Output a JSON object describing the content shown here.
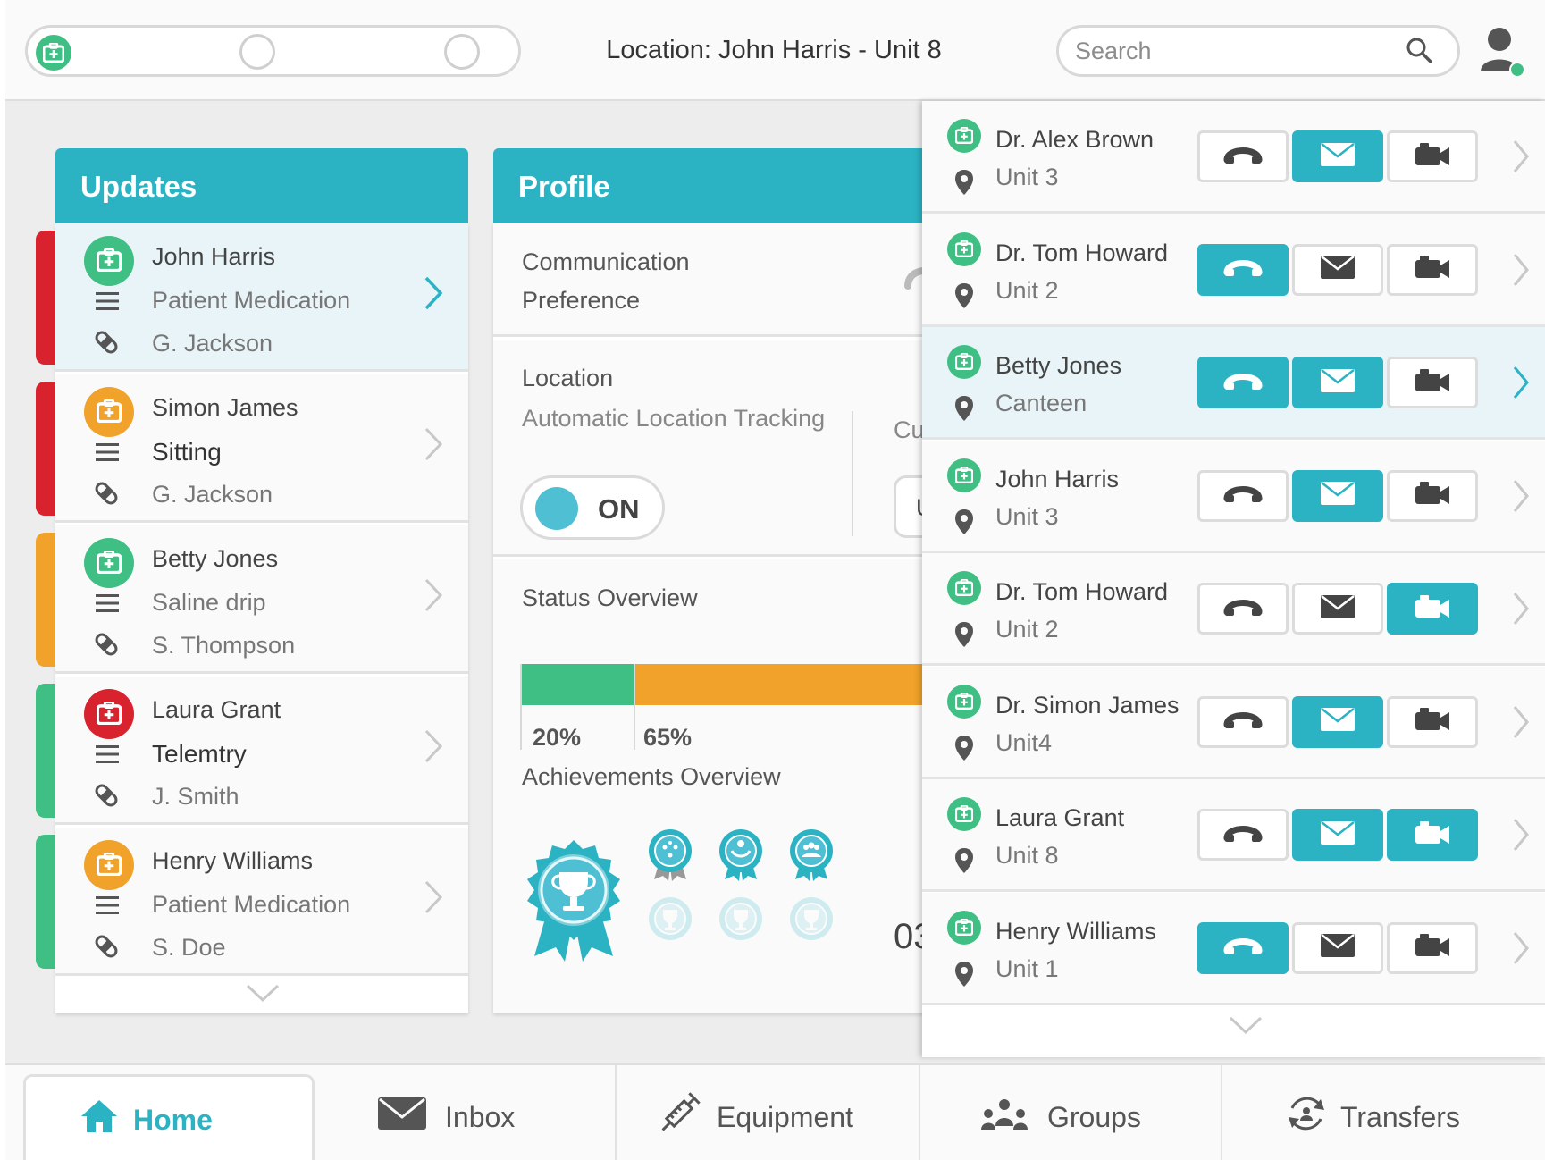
{
  "header": {
    "location": "Location: John Harris - Unit 8",
    "search_placeholder": "Search"
  },
  "colors": {
    "accent": "#2bb3c4",
    "green": "#3fbf84",
    "orange": "#f0a22a",
    "red": "#d8232e"
  },
  "updates": {
    "title": "Updates",
    "items": [
      {
        "name": "John Harris",
        "detail": "Patient Medication",
        "staff": "G. Jackson",
        "priority": "red",
        "category": "green"
      },
      {
        "name": "Simon James",
        "detail": "Sitting",
        "staff": "G. Jackson",
        "priority": "red",
        "category": "orange"
      },
      {
        "name": "Betty Jones",
        "detail": "Saline drip",
        "staff": "S. Thompson",
        "priority": "orange",
        "category": "green"
      },
      {
        "name": "Laura Grant",
        "detail": "Telemtry",
        "staff": "J. Smith",
        "priority": "green",
        "category": "red"
      },
      {
        "name": "Henry Williams",
        "detail": "Patient Medication",
        "staff": "S. Doe",
        "priority": "green",
        "category": "orange"
      }
    ]
  },
  "profile": {
    "title": "Profile",
    "communication_line1": "Communication",
    "communication_line2": "Preference",
    "location_title": "Location",
    "location_sub": "Automatic Location Tracking",
    "toggle_label": "ON",
    "cut_label": "Cu",
    "cut_box": "U",
    "status_title": "Status Overview",
    "status_green_pct": "20%",
    "status_orange_pct": "65%",
    "status_green_value": 20,
    "status_orange_value": 65,
    "achievements_title": "Achievements Overview",
    "achievements_cut_number": "03"
  },
  "contacts": [
    {
      "name": "Dr. Alex Brown",
      "location": "Unit 3",
      "call": false,
      "mail": true,
      "video": false
    },
    {
      "name": "Dr. Tom Howard",
      "location": "Unit 2",
      "call": true,
      "mail": false,
      "video": false
    },
    {
      "name": "Betty Jones",
      "location": "Canteen",
      "call": true,
      "mail": true,
      "video": false
    },
    {
      "name": "John Harris",
      "location": "Unit 3",
      "call": false,
      "mail": true,
      "video": false
    },
    {
      "name": "Dr. Tom Howard",
      "location": "Unit 2",
      "call": false,
      "mail": false,
      "video": true
    },
    {
      "name": "Dr. Simon James",
      "location": "Unit4",
      "call": false,
      "mail": true,
      "video": false
    },
    {
      "name": "Laura Grant",
      "location": "Unit 8",
      "call": false,
      "mail": true,
      "video": true
    },
    {
      "name": "Henry Williams",
      "location": "Unit 1",
      "call": true,
      "mail": false,
      "video": false
    }
  ],
  "nav": {
    "home": "Home",
    "inbox": "Inbox",
    "equipment": "Equipment",
    "groups": "Groups",
    "transfers": "Transfers"
  }
}
